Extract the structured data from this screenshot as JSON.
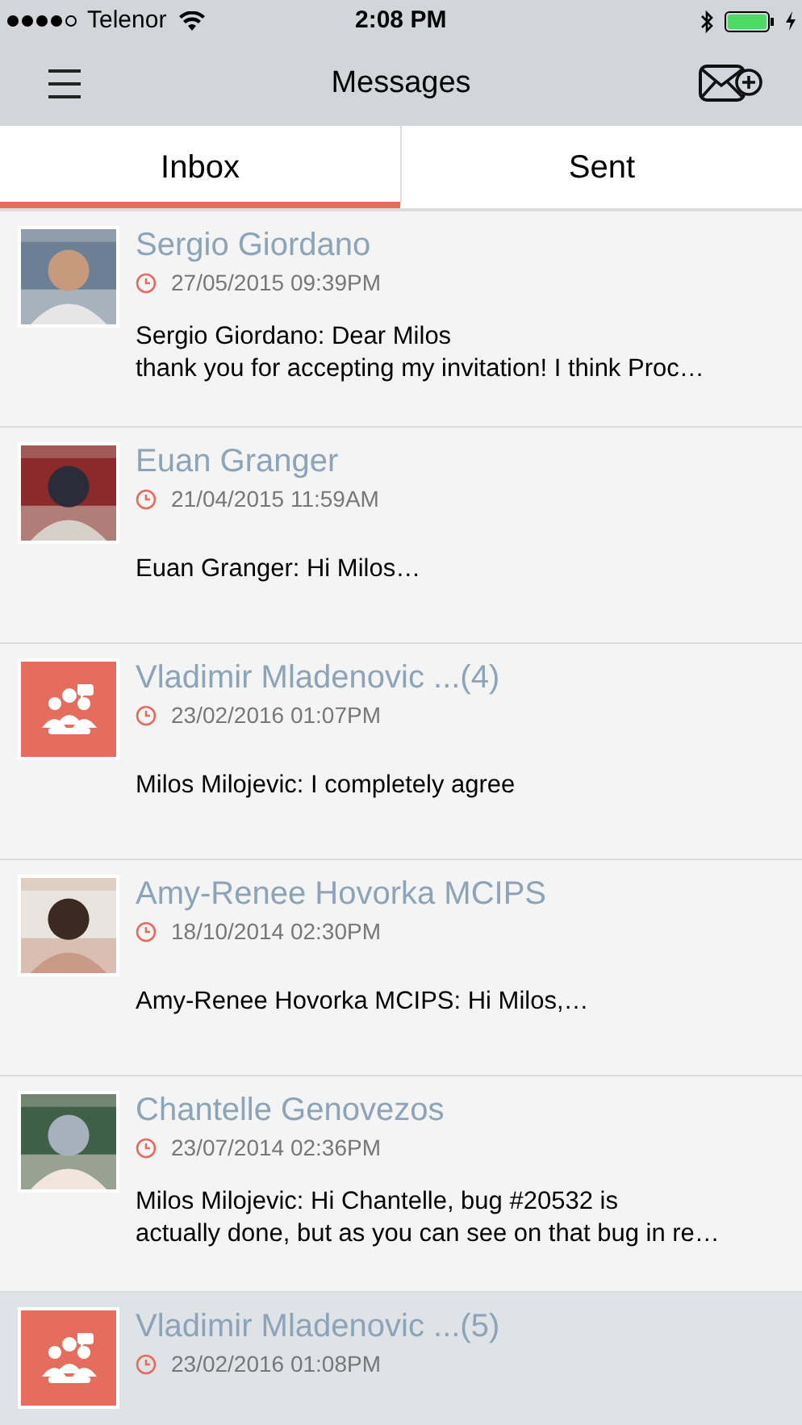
{
  "status_bar": {
    "carrier": "Telenor",
    "time": "2:08 PM",
    "battery_charging": true
  },
  "header": {
    "title": "Messages"
  },
  "tabs": [
    {
      "label": "Inbox",
      "selected": true
    },
    {
      "label": "Sent",
      "selected": false
    }
  ],
  "messages": [
    {
      "name": "Sergio Giordano",
      "date": "27/05/2015 09:39PM",
      "text": "Sergio Giordano: Dear Milos\nthank you for accepting my invitation! I think Proc…",
      "selected": false
    },
    {
      "name": "Euan Granger",
      "date": "21/04/2015 11:59AM",
      "text": "Euan Granger: Hi Milos…",
      "selected": false
    },
    {
      "name": "Vladimir Mladenovic ...(4)",
      "date": "23/02/2016 01:07PM",
      "text": "Milos Milojevic: I completely agree",
      "kind": "group",
      "selected": false
    },
    {
      "name": "Amy-Renee Hovorka MCIPS",
      "date": "18/10/2014 02:30PM",
      "text": "Amy-Renee Hovorka MCIPS: Hi Milos,…",
      "selected": false
    },
    {
      "name": "Chantelle Genovezos",
      "date": "23/07/2014 02:36PM",
      "text": "Milos Milojevic: Hi Chantelle, bug #20532 is\nactually done, but as you can see on that bug in re…",
      "selected": false
    },
    {
      "name": "Vladimir Mladenovic ...(5)",
      "date": "23/02/2016 01:08PM",
      "kind": "group",
      "selected": true
    }
  ]
}
